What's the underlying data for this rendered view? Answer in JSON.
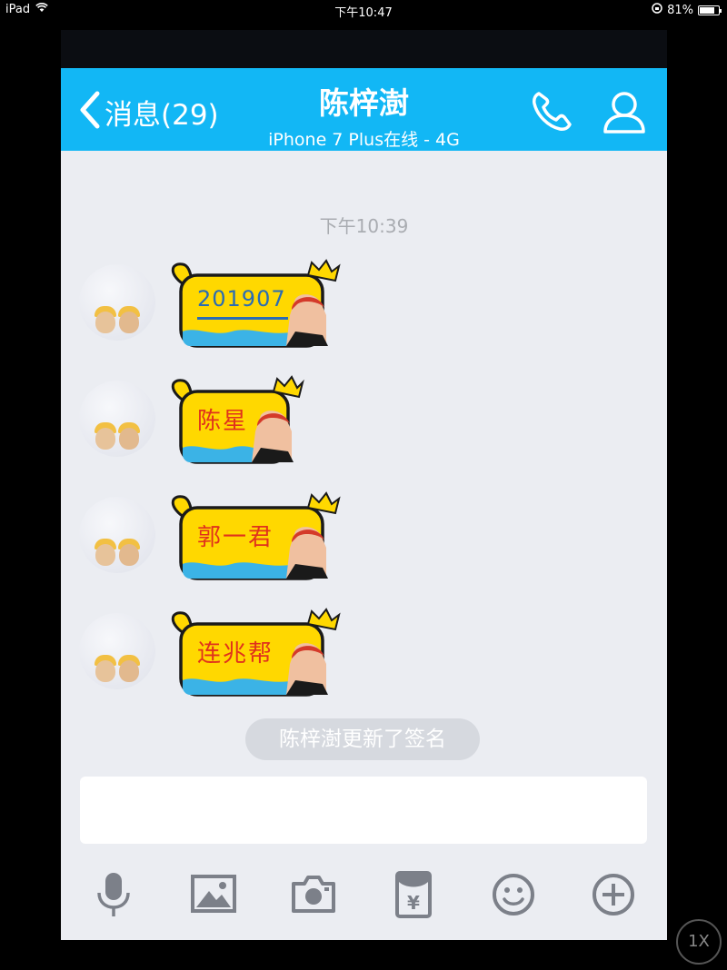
{
  "status_bar": {
    "device": "iPad",
    "time": "下午10:47",
    "battery": "81%",
    "battery_level": 0.81
  },
  "nav": {
    "back_label": "消息(29)",
    "title": "陈梓澍",
    "subtitle": "iPhone 7 Plus在线 - 4G"
  },
  "chat": {
    "timestamp": "下午10:39",
    "messages": [
      {
        "sender": "other",
        "text": "201907"
      },
      {
        "sender": "other",
        "text": "陈星"
      },
      {
        "sender": "other",
        "text": "郭一君"
      },
      {
        "sender": "other",
        "text": "连兆帮"
      }
    ],
    "system_notice": "陈梓澍更新了签名"
  },
  "toolbar": {
    "items": [
      "microphone-icon",
      "image-icon",
      "camera-icon",
      "red-packet-icon",
      "emoji-icon",
      "plus-icon"
    ]
  },
  "overlay": {
    "zoom_label": "1X"
  },
  "colors": {
    "nav_blue": "#12b7f5",
    "chat_bg": "#ebedf2",
    "bubble_yellow": "#ffd800",
    "icon_gray": "#7c8089"
  }
}
